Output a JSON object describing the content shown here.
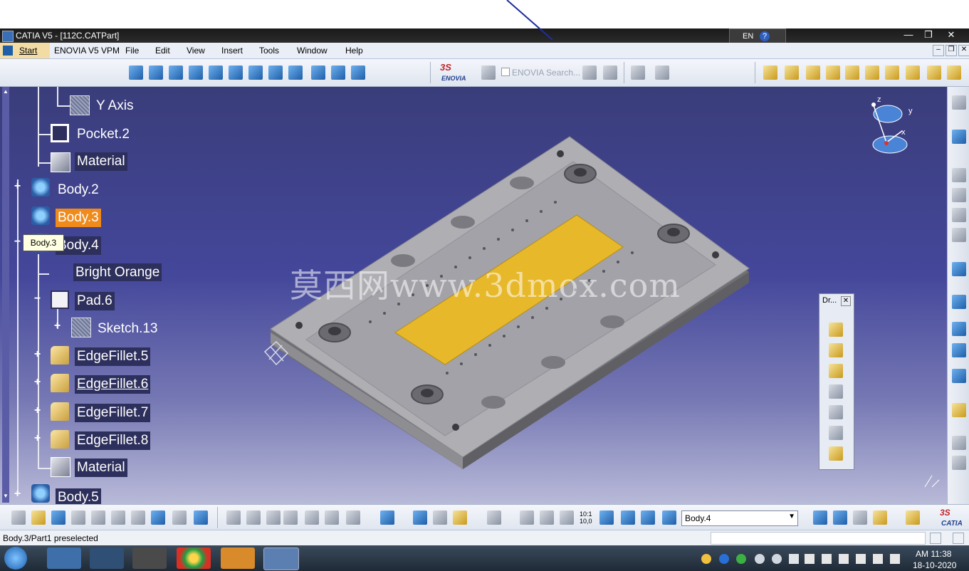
{
  "window": {
    "title": "CATIA V5 - [112C.CATPart]",
    "lang_indicator": "EN"
  },
  "menubar": {
    "items": [
      "Start",
      "ENOVIA V5 VPM",
      "File",
      "Edit",
      "View",
      "Insert",
      "Tools",
      "Window",
      "Help"
    ]
  },
  "toolbar_top": {
    "enovia_label": "ENOVIA",
    "enovia_search_label": "ENOVIA Search..."
  },
  "tree": {
    "nodes": [
      {
        "label": "Y Axis",
        "icon": "axis-icon"
      },
      {
        "label": "Pocket.2",
        "icon": "pocket-icon"
      },
      {
        "label": "Material",
        "icon": "material-icon"
      },
      {
        "label": "Body.2",
        "icon": "body-icon"
      },
      {
        "label": "Body.3",
        "icon": "body-icon",
        "selected": true
      },
      {
        "label": "Body.4",
        "icon": "body-icon"
      },
      {
        "label": "Bright Orange",
        "icon": ""
      },
      {
        "label": "Pad.6",
        "icon": "pad-icon"
      },
      {
        "label": "Sketch.13",
        "icon": "sketch-icon"
      },
      {
        "label": "EdgeFillet.5",
        "icon": "fillet-icon"
      },
      {
        "label": "EdgeFillet.6",
        "icon": "fillet-icon"
      },
      {
        "label": "EdgeFillet.7",
        "icon": "fillet-icon"
      },
      {
        "label": "EdgeFillet.8",
        "icon": "fillet-icon"
      },
      {
        "label": "Material",
        "icon": "material-icon"
      },
      {
        "label": "Body.5",
        "icon": "body-icon"
      }
    ],
    "tooltip": "Body.3"
  },
  "compass": {
    "x": "x",
    "y": "y",
    "z": "z"
  },
  "watermark": "莫西网www.3dmox.com",
  "dr_panel": {
    "title": "Dr..."
  },
  "toolbar_bottom": {
    "current_body": "Body.4",
    "scale_label": "10:1\n10,0"
  },
  "status": {
    "text": "Body.3/Part1 preselected"
  },
  "taskbar": {
    "time": "AM 11:38",
    "date": "18-10-2020"
  },
  "brand": "CATIA",
  "colors": {
    "selection": "#f08a1a",
    "part_pad": "#e6b82a",
    "part_body": "#a9a9ad"
  }
}
